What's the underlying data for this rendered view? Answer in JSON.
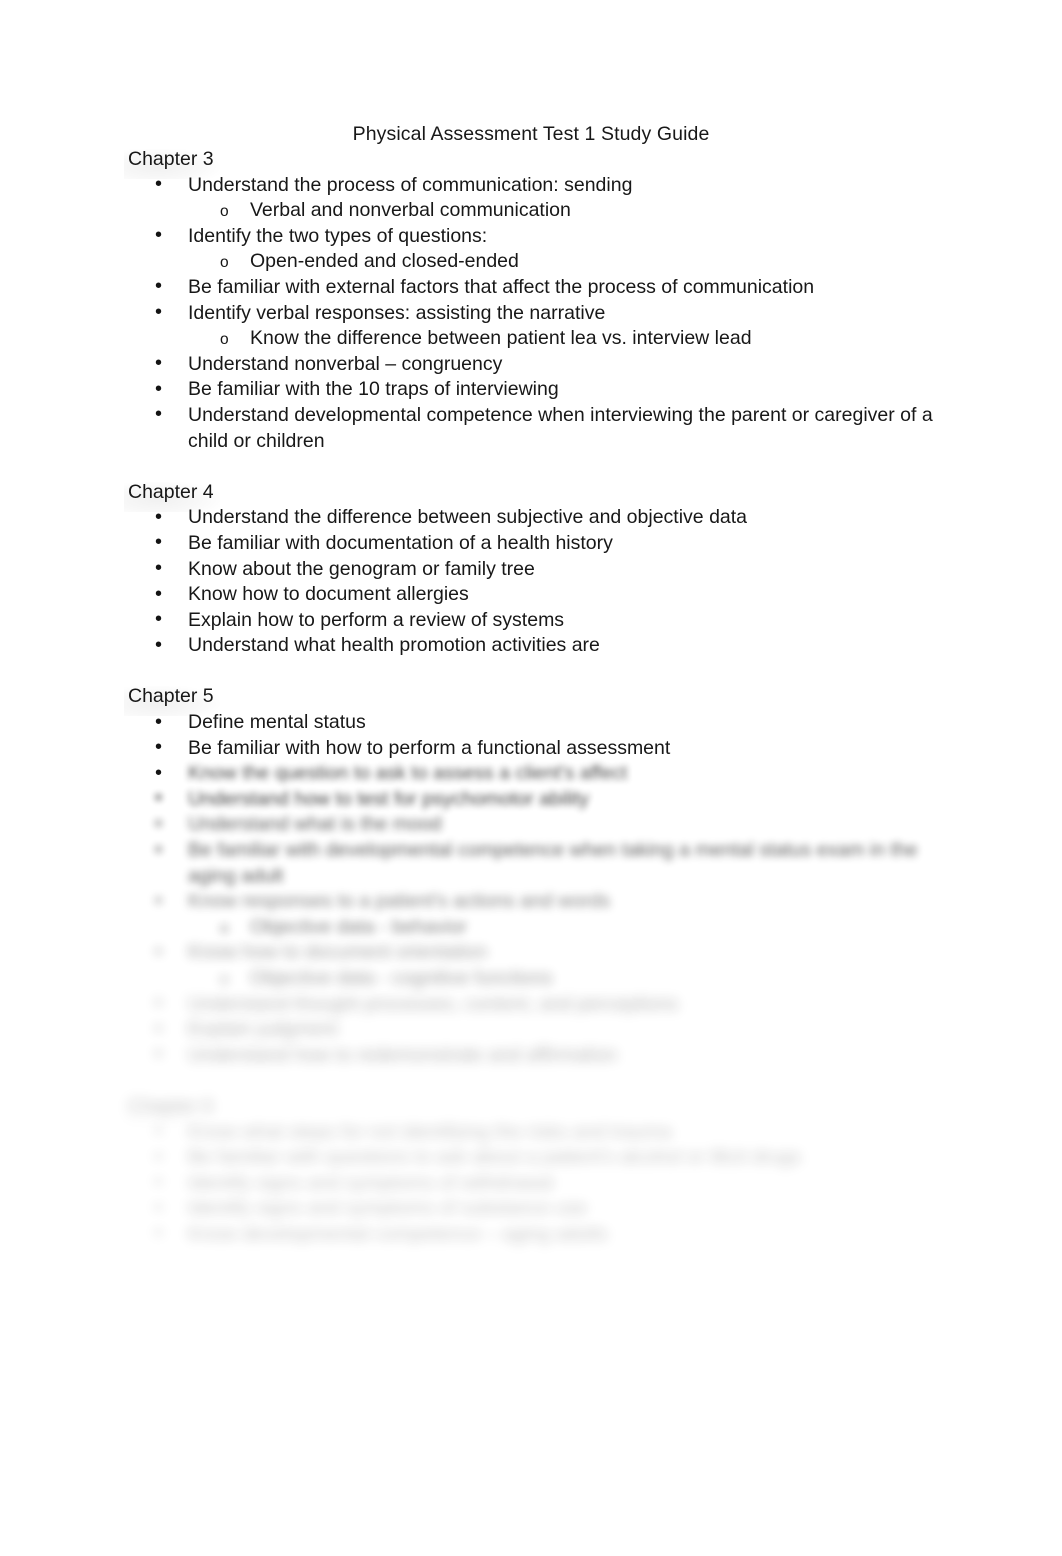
{
  "document": {
    "title": "Physical Assessment Test 1 Study Guide",
    "background_color": "#ffffff",
    "text_color": "#181818"
  },
  "sections": [
    {
      "heading": "Chapter 3",
      "blurred": false,
      "items": [
        {
          "level": 1,
          "text": "Understand the process of communication: sending",
          "blurred": false
        },
        {
          "level": 2,
          "text": "Verbal and nonverbal communication",
          "blurred": false
        },
        {
          "level": 1,
          "text": "Identify the two types of questions:",
          "blurred": false
        },
        {
          "level": 2,
          "text": "Open-ended and closed-ended",
          "blurred": false
        },
        {
          "level": 1,
          "text": "Be familiar with external factors that affect the process of communication",
          "blurred": false
        },
        {
          "level": 1,
          "text": "Identify verbal responses: assisting the narrative",
          "blurred": false
        },
        {
          "level": 2,
          "text": "Know the difference between patient lea vs. interview lead",
          "blurred": false
        },
        {
          "level": 1,
          "text": "Understand nonverbal – congruency",
          "blurred": false
        },
        {
          "level": 1,
          "text": "Be familiar with the 10 traps of interviewing",
          "blurred": false
        },
        {
          "level": 1,
          "text": "Understand developmental competence when interviewing the parent or caregiver of a child or children",
          "blurred": false
        }
      ]
    },
    {
      "heading": "Chapter 4",
      "blurred": false,
      "items": [
        {
          "level": 1,
          "text": "Understand the difference between subjective and objective data",
          "blurred": false
        },
        {
          "level": 1,
          "text": "Be familiar with documentation of a health history",
          "blurred": false
        },
        {
          "level": 1,
          "text": "Know about the genogram or family tree",
          "blurred": false
        },
        {
          "level": 1,
          "text": "Know how to document allergies",
          "blurred": false
        },
        {
          "level": 1,
          "text": "Explain how to perform a review of systems",
          "blurred": false
        },
        {
          "level": 1,
          "text": "Understand what health promotion activities are",
          "blurred": false
        }
      ]
    },
    {
      "heading": "Chapter 5",
      "blurred": false,
      "items": [
        {
          "level": 1,
          "text": "Define mental status",
          "blurred": false
        },
        {
          "level": 1,
          "text": "Be familiar with how to perform a functional assessment",
          "blurred": false
        },
        {
          "level": 1,
          "text": "Know the question to ask to assess a client's affect",
          "blurred": true,
          "blur_level": "a",
          "sharp_bullet": true
        },
        {
          "level": 1,
          "text": "Understand how to test for psychomotor ability",
          "blurred": true,
          "blur_level": "a"
        },
        {
          "level": 1,
          "text": "Understand what is the mood",
          "blurred": true,
          "blur_level": "b"
        },
        {
          "level": 1,
          "text": "Be familiar with developmental competence when taking a mental status exam in the aging adult",
          "blurred": true,
          "blur_level": "b"
        },
        {
          "level": 1,
          "text": "Know responses to a patient's actions and words",
          "blurred": true,
          "blur_level": "c"
        },
        {
          "level": 2,
          "text": "Objective data - behavior",
          "blurred": true,
          "blur_level": "c"
        },
        {
          "level": 1,
          "text": "Know how to document orientation",
          "blurred": true,
          "blur_level": "d"
        },
        {
          "level": 2,
          "text": "Objective data - cognitive functions",
          "blurred": true,
          "blur_level": "d"
        },
        {
          "level": 1,
          "text": "Understand thought processes, content, and perceptions",
          "blurred": true,
          "blur_level": "e"
        },
        {
          "level": 1,
          "text": "Explain judgment",
          "blurred": true,
          "blur_level": "e"
        },
        {
          "level": 1,
          "text": "Understand how to redemonstrate and affirmation",
          "blurred": true,
          "blur_level": "e"
        }
      ]
    },
    {
      "heading": "Chapter 6",
      "blurred": true,
      "heading_blur_level": "f",
      "items": [
        {
          "level": 1,
          "text": "Know what steps for not identifying the risks and trauma",
          "blurred": true,
          "blur_level": "f"
        },
        {
          "level": 1,
          "text": "Be familiar with questions to ask about a patient's alcohol or illicit drugs",
          "blurred": true,
          "blur_level": "f"
        },
        {
          "level": 1,
          "text": "Identify signs and symptoms of withdrawal",
          "blurred": true,
          "blur_level": "f"
        },
        {
          "level": 1,
          "text": "Identify signs and symptoms of substance use",
          "blurred": true,
          "blur_level": "f"
        },
        {
          "level": 1,
          "text": "Know developmental competence – aging adults",
          "blurred": true,
          "blur_level": "f"
        }
      ]
    }
  ]
}
